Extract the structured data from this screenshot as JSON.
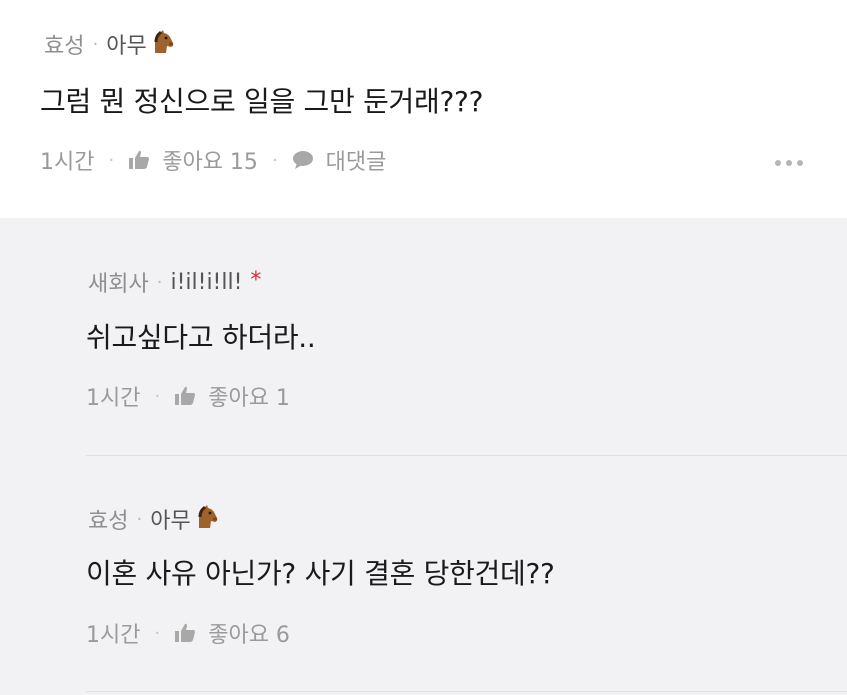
{
  "comments": [
    {
      "author": "효성",
      "nickname": "아무",
      "nickname_icon": "horse-face-icon",
      "text": "그럼 뭔 정신으로 일을 그만 둔거래???",
      "time": "1시간",
      "like_label": "좋아요 15",
      "reply_label": "대댓글"
    }
  ],
  "replies": [
    {
      "author": "새회사",
      "nickname": "i!il!i!ll!",
      "badge": "*",
      "text": "쉬고싶다고 하더라..",
      "time": "1시간",
      "like_label": "좋아요 1"
    },
    {
      "author": "효성",
      "nickname": "아무",
      "nickname_icon": "horse-face-icon",
      "text": "이혼 사유 아닌가? 사기 결혼 당한건데??",
      "time": "1시간",
      "like_label": "좋아요 6"
    }
  ],
  "colors": {
    "reply_background": "#f2f2f4",
    "badge_red": "#e0292d",
    "meta_gray": "#8f8f8f"
  }
}
